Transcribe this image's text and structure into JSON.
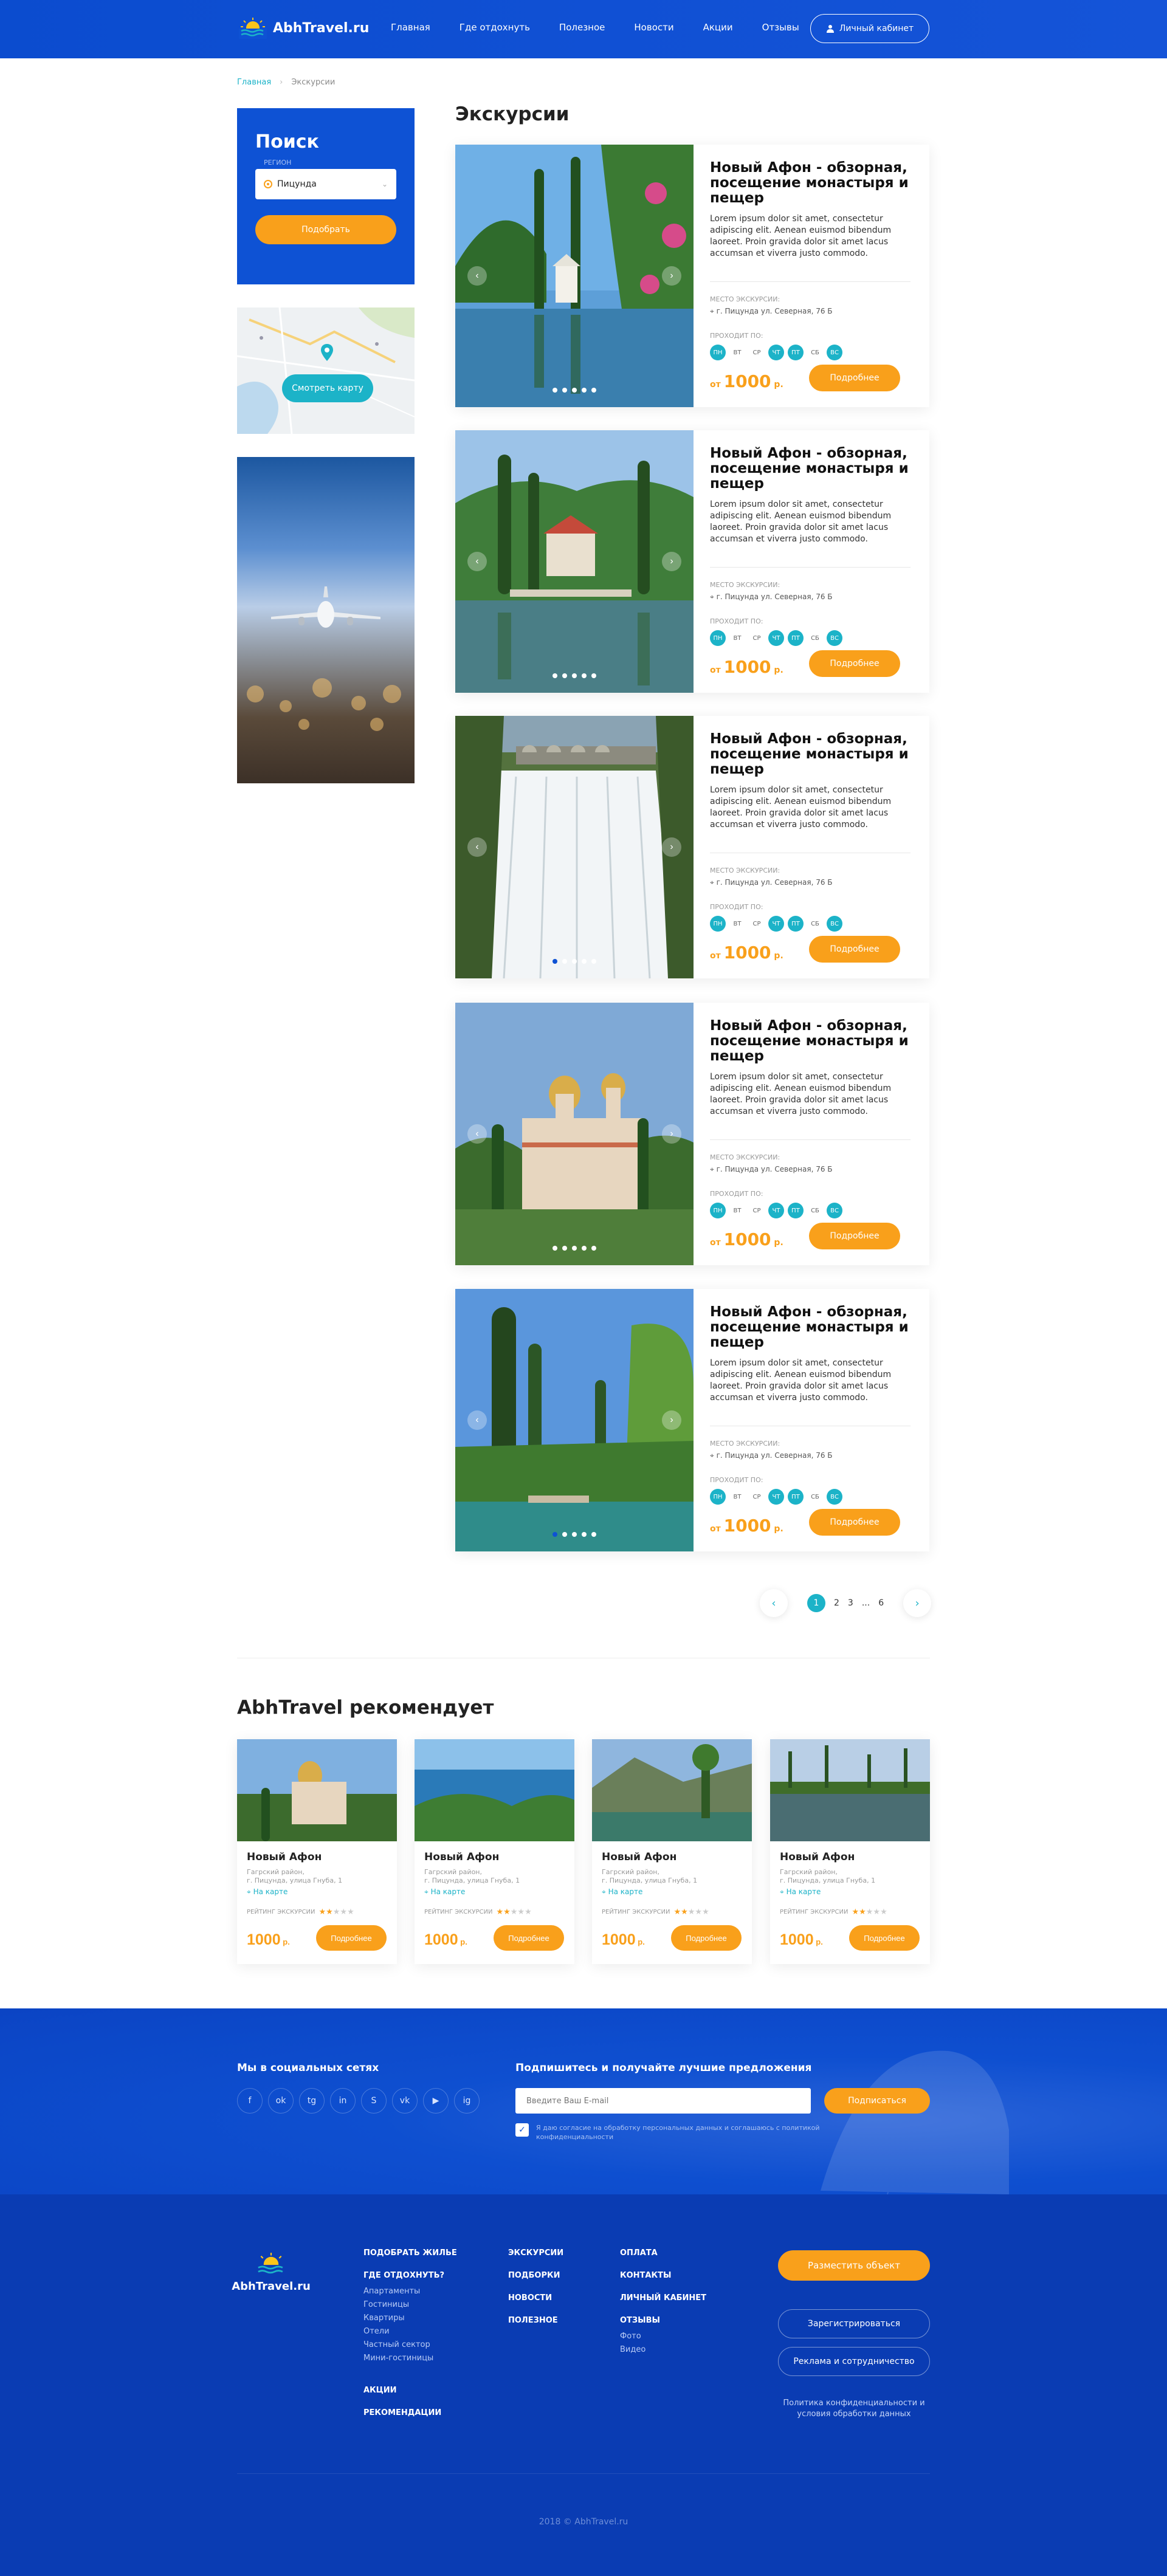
{
  "header": {
    "logo": "AbhTravel.ru",
    "nav": [
      "Главная",
      "Где отдохнуть",
      "Полезное",
      "Новости",
      "Акции",
      "Отзывы"
    ],
    "cabinet": "Личный кабинет"
  },
  "breadcrumb": {
    "home": "Главная",
    "current": "Экскурсии"
  },
  "search": {
    "title": "Поиск",
    "region_label": "РЕГИОН",
    "region_value": "Пицунда",
    "button": "Подобрать"
  },
  "map": {
    "button": "Смотреть карту"
  },
  "page_title": "Экскурсии",
  "cards": [
    {
      "title": "Новый Афон - обзорная, посещение монастыря и пещер",
      "text": "Lorem ipsum dolor sit amet, consectetur adipiscing elit. Aenean euismod bibendum laoreet. Proin gravida dolor sit amet lacus accumsan et viverra justo commodo.",
      "place_label": "МЕСТО ЭКСКУРСИИ:",
      "address": "г. Пицунда ул. Северная, 76 Б",
      "days_label": "ПРОХОДИТ ПО:",
      "price_from": "от",
      "price": "1000",
      "currency": "р.",
      "button": "Подробнее"
    },
    {
      "title": "Новый Афон - обзорная, посещение монастыря и пещер",
      "text": "Lorem ipsum dolor sit amet, consectetur adipiscing elit. Aenean euismod bibendum laoreet. Proin gravida dolor sit amet lacus accumsan et viverra justo commodo.",
      "place_label": "МЕСТО ЭКСКУРСИИ:",
      "address": "г. Пицунда ул. Северная, 76 Б",
      "days_label": "ПРОХОДИТ ПО:",
      "price_from": "от",
      "price": "1000",
      "currency": "р.",
      "button": "Подробнее"
    },
    {
      "title": "Новый Афон - обзорная, посещение монастыря и пещер",
      "text": "Lorem ipsum dolor sit amet, consectetur adipiscing elit. Aenean euismod bibendum laoreet. Proin gravida dolor sit amet lacus accumsan et viverra justo commodo.",
      "place_label": "МЕСТО ЭКСКУРСИИ:",
      "address": "г. Пицунда ул. Северная, 76 Б",
      "days_label": "ПРОХОДИТ ПО:",
      "price_from": "от",
      "price": "1000",
      "currency": "р.",
      "button": "Подробнее"
    },
    {
      "title": "Новый Афон - обзорная, посещение монастыря и пещер",
      "text": "Lorem ipsum dolor sit amet, consectetur adipiscing elit. Aenean euismod bibendum laoreet. Proin gravida dolor sit amet lacus accumsan et viverra justo commodo.",
      "place_label": "МЕСТО ЭКСКУРСИИ:",
      "address": "г. Пицунда ул. Северная, 76 Б",
      "days_label": "ПРОХОДИТ ПО:",
      "price_from": "от",
      "price": "1000",
      "currency": "р.",
      "button": "Подробнее"
    },
    {
      "title": "Новый Афон - обзорная, посещение монастыря и пещер",
      "text": "Lorem ipsum dolor sit amet, consectetur adipiscing elit. Aenean euismod bibendum laoreet. Proin gravida dolor sit amet lacus accumsan et viverra justo commodo.",
      "place_label": "МЕСТО ЭКСКУРСИИ:",
      "address": "г. Пицунда ул. Северная, 76 Б",
      "days_label": "ПРОХОДИТ ПО:",
      "price_from": "от",
      "price": "1000",
      "currency": "р.",
      "button": "Подробнее"
    }
  ],
  "days": [
    "ПН",
    "ВТ",
    "СР",
    "ЧТ",
    "ПТ",
    "СБ",
    "ВС"
  ],
  "pagination": {
    "pages": [
      "1",
      "2",
      "3",
      "...",
      "6"
    ],
    "active": "1"
  },
  "recommend": {
    "title": "AbhTravel рекомендует",
    "items": [
      {
        "name": "Новый Афон",
        "district": "Гагрский район,",
        "addr": "г. Пицунда, улица Гнуба, 1",
        "map": "На карте",
        "rating_label": "РЕЙТИНГ ЭКСКУРСИИ",
        "price": "1000",
        "currency": "р.",
        "button": "Подробнее"
      },
      {
        "name": "Новый Афон",
        "district": "Гагрский район,",
        "addr": "г. Пицунда, улица Гнуба, 1",
        "map": "На карте",
        "rating_label": "РЕЙТИНГ ЭКСКУРСИИ",
        "price": "1000",
        "currency": "р.",
        "button": "Подробнее"
      },
      {
        "name": "Новый Афон",
        "district": "Гагрский район,",
        "addr": "г. Пицунда, улица Гнуба, 1",
        "map": "На карте",
        "rating_label": "РЕЙТИНГ ЭКСКУРСИИ",
        "price": "1000",
        "currency": "р.",
        "button": "Подробнее"
      },
      {
        "name": "Новый Афон",
        "district": "Гагрский район,",
        "addr": "г. Пицунда, улица Гнуба, 1",
        "map": "На карте",
        "rating_label": "РЕЙТИНГ ЭКСКУРСИИ",
        "price": "1000",
        "currency": "р.",
        "button": "Подробнее"
      }
    ]
  },
  "social": {
    "title": "Мы в социальных сетях",
    "icons": [
      "f",
      "ok",
      "tg",
      "in",
      "S",
      "vk",
      "▶",
      "ig"
    ]
  },
  "subscribe": {
    "title": "Подпишитесь и получайте лучшие предложения",
    "placeholder": "Введите Ваш E-mail",
    "button": "Подписаться",
    "agree": "Я даю согласие на обработку персональных данных и соглашаюсь с политикой конфиденциальности"
  },
  "footer": {
    "logo": "AbhTravel.ru",
    "col1": {
      "h1": "ПОДОБРАТЬ ЖИЛЬЕ",
      "h2": "ГДЕ ОТДОХНУТЬ?",
      "links": [
        "Апартаменты",
        "Гостиницы",
        "Квартиры",
        "Отели",
        "Частный сектор",
        "Мини-гостиницы"
      ],
      "h3": "АКЦИИ",
      "h4": "РЕКОМЕНДАЦИИ"
    },
    "col2": [
      "ЭКСКУРСИИ",
      "ПОДБОРКИ",
      "НОВОСТИ",
      "ПОЛЕЗНОЕ"
    ],
    "col3": {
      "items": [
        "ОПЛАТА",
        "КОНТАКТЫ",
        "ЛИЧНЫЙ КАБИНЕТ",
        "ОТЗЫВЫ"
      ],
      "sub": [
        "Фото",
        "Видео"
      ]
    },
    "place_button": "Разместить объект",
    "register": "Зарегистрироваться",
    "ads": "Реклама и сотрудничество",
    "policy": "Политика конфиденциальности и условия обработки данных",
    "copyright": "2018 © AbhTravel.ru"
  },
  "colors": {
    "brand": "#0e52d4",
    "accent": "#f9a01b",
    "teal": "#1cb3c8",
    "footer": "#0a3cb3"
  }
}
